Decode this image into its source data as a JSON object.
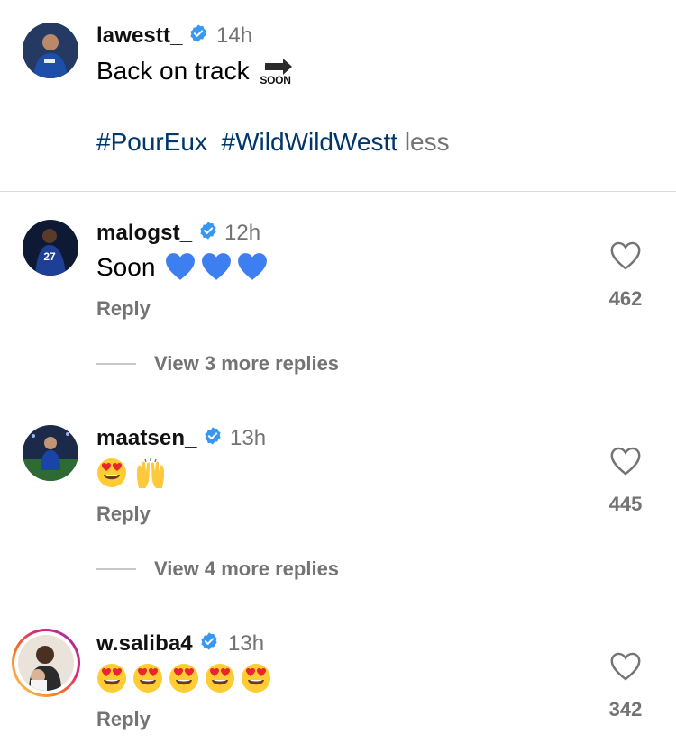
{
  "caption": {
    "username": "lawestt_",
    "time": "14h",
    "text": "Back on track",
    "soon_label": "SOON",
    "hashtags": [
      "#PourEux",
      "#WildWildWestt"
    ],
    "less_label": "less"
  },
  "comments": [
    {
      "username": "malogst_",
      "time": "12h",
      "text": "Soon",
      "emojis": [
        "blue-heart",
        "blue-heart",
        "blue-heart"
      ],
      "reply_label": "Reply",
      "likes": "462",
      "more_replies": "View 3 more replies"
    },
    {
      "username": "maatsen_",
      "time": "13h",
      "text": "",
      "emojis": [
        "heart-eyes",
        "raising-hands"
      ],
      "reply_label": "Reply",
      "likes": "445",
      "more_replies": "View 4 more replies"
    },
    {
      "username": "w.saliba4",
      "time": "13h",
      "text": "",
      "emojis": [
        "heart-eyes",
        "heart-eyes",
        "heart-eyes",
        "heart-eyes",
        "heart-eyes"
      ],
      "reply_label": "Reply",
      "likes": "342"
    }
  ],
  "colors": {
    "verified": "#3897f0",
    "hashtag": "#00376b",
    "secondary": "#737373",
    "story_ring_start": "#feda75",
    "story_ring_end": "#d62976"
  }
}
